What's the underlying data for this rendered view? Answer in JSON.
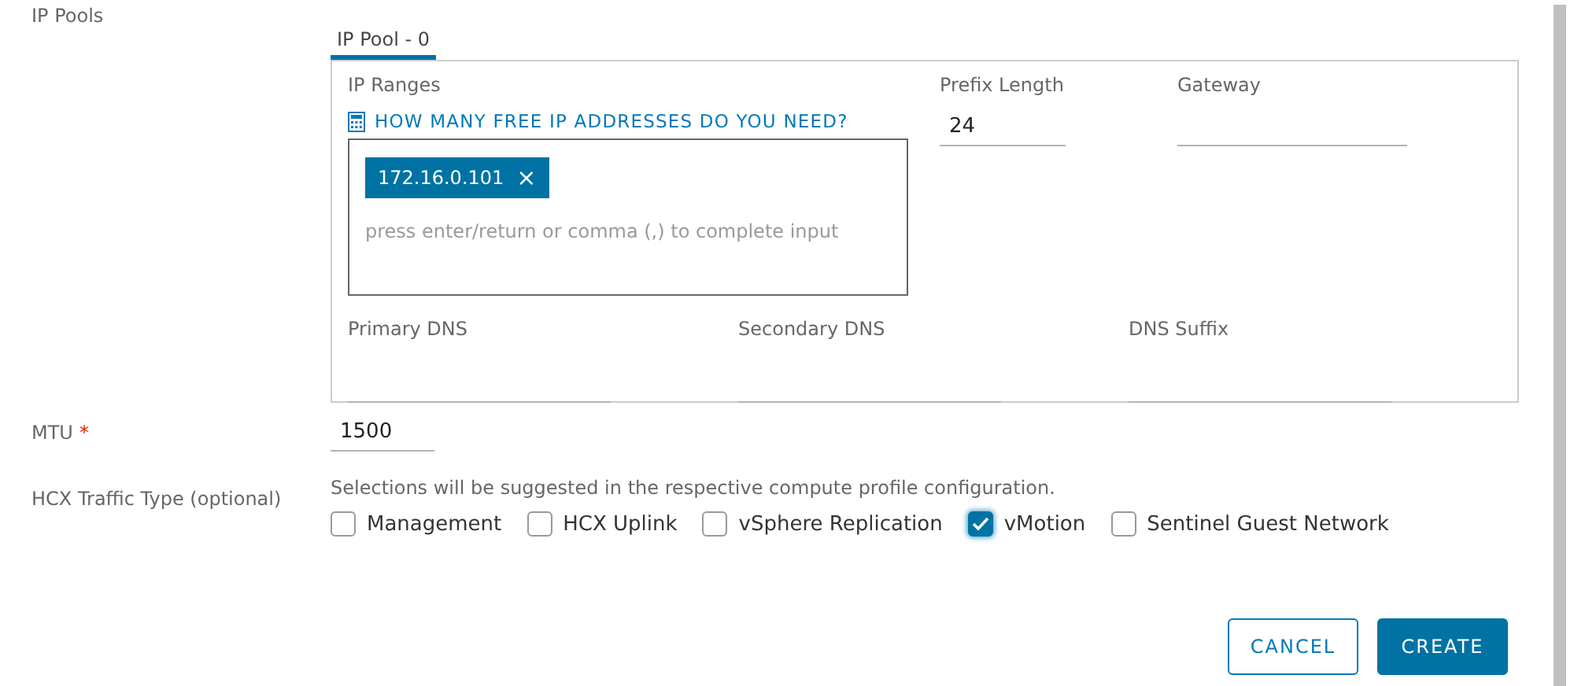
{
  "ip_pools": {
    "label": "IP Pools",
    "tabs": [
      {
        "label": "IP Pool - 0",
        "selected": true
      }
    ],
    "ip_ranges": {
      "label": "IP Ranges",
      "link": "HOW MANY FREE IP ADDRESSES DO YOU NEED?",
      "tags": [
        "172.16.0.101"
      ],
      "remove_glyph": "×",
      "placeholder": "press enter/return or comma (,) to complete input"
    },
    "prefix_length": {
      "label": "Prefix Length",
      "value": "24"
    },
    "gateway": {
      "label": "Gateway"
    },
    "dns_fields": [
      {
        "label": "Primary DNS"
      },
      {
        "label": "Secondary DNS"
      },
      {
        "label": "DNS Suffix"
      }
    ]
  },
  "mtu": {
    "label": "MTU",
    "required_mark": "*",
    "value": "1500"
  },
  "traffic_type": {
    "label": "HCX Traffic Type (optional)",
    "help": "Selections will be suggested in the respective compute profile configuration.",
    "options": [
      {
        "label": "Management",
        "checked": false
      },
      {
        "label": "HCX Uplink",
        "checked": false
      },
      {
        "label": "vSphere Replication",
        "checked": false
      },
      {
        "label": "vMotion",
        "checked": true
      },
      {
        "label": "Sentinel Guest Network",
        "checked": false
      }
    ]
  },
  "buttons": [
    {
      "label": "CANCEL",
      "kind": "secondary"
    },
    {
      "label": "CREATE",
      "kind": "primary"
    }
  ]
}
